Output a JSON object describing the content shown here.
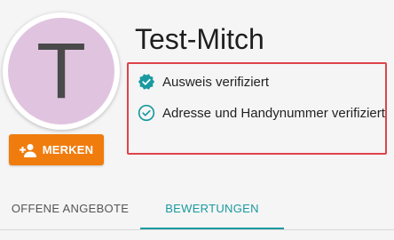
{
  "profile": {
    "avatar_letter": "T",
    "username": "Test-Mitch",
    "avatar_color": "#e0c4df"
  },
  "actions": {
    "merken_label": "MERKEN",
    "merken_icon": "person-add-icon",
    "merken_color": "#f07c0e"
  },
  "verification": {
    "items": [
      {
        "label": "Ausweis verifiziert",
        "icon": "verified-badge-icon"
      },
      {
        "label": "Adresse und Handynummer verifiziert",
        "icon": "check-circle-icon"
      }
    ],
    "icon_color": "#1a9aa0",
    "highlight_color": "#e0434b"
  },
  "tabs": {
    "items": [
      {
        "label": "OFFENE ANGEBOTE",
        "active": false
      },
      {
        "label": "BEWERTUNGEN",
        "active": true
      }
    ],
    "active_color": "#1a9aa0"
  }
}
